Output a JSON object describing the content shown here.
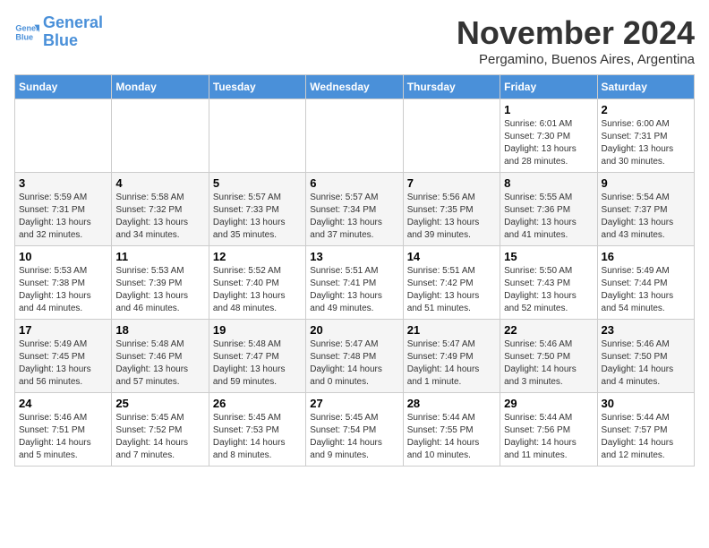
{
  "header": {
    "logo_line1": "General",
    "logo_line2": "Blue",
    "month_title": "November 2024",
    "subtitle": "Pergamino, Buenos Aires, Argentina"
  },
  "days_of_week": [
    "Sunday",
    "Monday",
    "Tuesday",
    "Wednesday",
    "Thursday",
    "Friday",
    "Saturday"
  ],
  "weeks": [
    [
      {
        "day": "",
        "info": ""
      },
      {
        "day": "",
        "info": ""
      },
      {
        "day": "",
        "info": ""
      },
      {
        "day": "",
        "info": ""
      },
      {
        "day": "",
        "info": ""
      },
      {
        "day": "1",
        "info": "Sunrise: 6:01 AM\nSunset: 7:30 PM\nDaylight: 13 hours\nand 28 minutes."
      },
      {
        "day": "2",
        "info": "Sunrise: 6:00 AM\nSunset: 7:31 PM\nDaylight: 13 hours\nand 30 minutes."
      }
    ],
    [
      {
        "day": "3",
        "info": "Sunrise: 5:59 AM\nSunset: 7:31 PM\nDaylight: 13 hours\nand 32 minutes."
      },
      {
        "day": "4",
        "info": "Sunrise: 5:58 AM\nSunset: 7:32 PM\nDaylight: 13 hours\nand 34 minutes."
      },
      {
        "day": "5",
        "info": "Sunrise: 5:57 AM\nSunset: 7:33 PM\nDaylight: 13 hours\nand 35 minutes."
      },
      {
        "day": "6",
        "info": "Sunrise: 5:57 AM\nSunset: 7:34 PM\nDaylight: 13 hours\nand 37 minutes."
      },
      {
        "day": "7",
        "info": "Sunrise: 5:56 AM\nSunset: 7:35 PM\nDaylight: 13 hours\nand 39 minutes."
      },
      {
        "day": "8",
        "info": "Sunrise: 5:55 AM\nSunset: 7:36 PM\nDaylight: 13 hours\nand 41 minutes."
      },
      {
        "day": "9",
        "info": "Sunrise: 5:54 AM\nSunset: 7:37 PM\nDaylight: 13 hours\nand 43 minutes."
      }
    ],
    [
      {
        "day": "10",
        "info": "Sunrise: 5:53 AM\nSunset: 7:38 PM\nDaylight: 13 hours\nand 44 minutes."
      },
      {
        "day": "11",
        "info": "Sunrise: 5:53 AM\nSunset: 7:39 PM\nDaylight: 13 hours\nand 46 minutes."
      },
      {
        "day": "12",
        "info": "Sunrise: 5:52 AM\nSunset: 7:40 PM\nDaylight: 13 hours\nand 48 minutes."
      },
      {
        "day": "13",
        "info": "Sunrise: 5:51 AM\nSunset: 7:41 PM\nDaylight: 13 hours\nand 49 minutes."
      },
      {
        "day": "14",
        "info": "Sunrise: 5:51 AM\nSunset: 7:42 PM\nDaylight: 13 hours\nand 51 minutes."
      },
      {
        "day": "15",
        "info": "Sunrise: 5:50 AM\nSunset: 7:43 PM\nDaylight: 13 hours\nand 52 minutes."
      },
      {
        "day": "16",
        "info": "Sunrise: 5:49 AM\nSunset: 7:44 PM\nDaylight: 13 hours\nand 54 minutes."
      }
    ],
    [
      {
        "day": "17",
        "info": "Sunrise: 5:49 AM\nSunset: 7:45 PM\nDaylight: 13 hours\nand 56 minutes."
      },
      {
        "day": "18",
        "info": "Sunrise: 5:48 AM\nSunset: 7:46 PM\nDaylight: 13 hours\nand 57 minutes."
      },
      {
        "day": "19",
        "info": "Sunrise: 5:48 AM\nSunset: 7:47 PM\nDaylight: 13 hours\nand 59 minutes."
      },
      {
        "day": "20",
        "info": "Sunrise: 5:47 AM\nSunset: 7:48 PM\nDaylight: 14 hours\nand 0 minutes."
      },
      {
        "day": "21",
        "info": "Sunrise: 5:47 AM\nSunset: 7:49 PM\nDaylight: 14 hours\nand 1 minute."
      },
      {
        "day": "22",
        "info": "Sunrise: 5:46 AM\nSunset: 7:50 PM\nDaylight: 14 hours\nand 3 minutes."
      },
      {
        "day": "23",
        "info": "Sunrise: 5:46 AM\nSunset: 7:50 PM\nDaylight: 14 hours\nand 4 minutes."
      }
    ],
    [
      {
        "day": "24",
        "info": "Sunrise: 5:46 AM\nSunset: 7:51 PM\nDaylight: 14 hours\nand 5 minutes."
      },
      {
        "day": "25",
        "info": "Sunrise: 5:45 AM\nSunset: 7:52 PM\nDaylight: 14 hours\nand 7 minutes."
      },
      {
        "day": "26",
        "info": "Sunrise: 5:45 AM\nSunset: 7:53 PM\nDaylight: 14 hours\nand 8 minutes."
      },
      {
        "day": "27",
        "info": "Sunrise: 5:45 AM\nSunset: 7:54 PM\nDaylight: 14 hours\nand 9 minutes."
      },
      {
        "day": "28",
        "info": "Sunrise: 5:44 AM\nSunset: 7:55 PM\nDaylight: 14 hours\nand 10 minutes."
      },
      {
        "day": "29",
        "info": "Sunrise: 5:44 AM\nSunset: 7:56 PM\nDaylight: 14 hours\nand 11 minutes."
      },
      {
        "day": "30",
        "info": "Sunrise: 5:44 AM\nSunset: 7:57 PM\nDaylight: 14 hours\nand 12 minutes."
      }
    ]
  ]
}
